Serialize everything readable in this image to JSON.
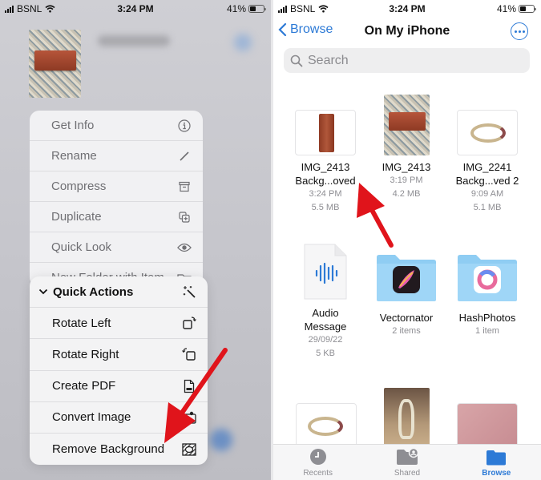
{
  "status_bar": {
    "carrier": "BSNL",
    "time": "3:24 PM",
    "battery": "41%",
    "battery_level": 0.41
  },
  "left": {
    "context_menu": [
      {
        "label": "Get Info",
        "icon": "info-icon"
      },
      {
        "label": "Rename",
        "icon": "pencil-icon"
      },
      {
        "label": "Compress",
        "icon": "archive-box-icon"
      },
      {
        "label": "Duplicate",
        "icon": "duplicate-icon"
      },
      {
        "label": "Quick Look",
        "icon": "eye-icon"
      },
      {
        "label": "New Folder with Item",
        "icon": "folder-badge-icon"
      }
    ],
    "quick_actions": {
      "header": "Quick Actions",
      "items": [
        {
          "label": "Rotate Left",
          "icon": "rotate-left-icon"
        },
        {
          "label": "Rotate Right",
          "icon": "rotate-right-icon"
        },
        {
          "label": "Create PDF",
          "icon": "pdf-icon"
        },
        {
          "label": "Convert Image",
          "icon": "convert-image-icon"
        },
        {
          "label": "Remove Background",
          "icon": "remove-background-icon"
        }
      ]
    }
  },
  "right": {
    "back_label": "Browse",
    "title": "On My iPhone",
    "search_placeholder": "Search",
    "files": [
      {
        "name1": "IMG_2413",
        "name2": "Backg...oved",
        "time": "3:24 PM",
        "size": "5.5 MB"
      },
      {
        "name1": "IMG_2413",
        "name2": "",
        "time": "3:19 PM",
        "size": "4.2 MB"
      },
      {
        "name1": "IMG_2241",
        "name2": "Backg...ved 2",
        "time": "9:09 AM",
        "size": "5.1 MB"
      },
      {
        "name1": "Audio",
        "name2": "Message",
        "time": "29/09/22",
        "size": "5 KB"
      },
      {
        "name1": "Vectornator",
        "name2": "",
        "time": "2 items",
        "size": ""
      },
      {
        "name1": "HashPhotos",
        "name2": "",
        "time": "1 item",
        "size": ""
      }
    ],
    "tabs": [
      {
        "label": "Recents"
      },
      {
        "label": "Shared"
      },
      {
        "label": "Browse"
      }
    ]
  },
  "colors": {
    "accent": "#2d7ad6",
    "annotation_arrow": "#e0141b",
    "folder": "#8fcdf3"
  }
}
